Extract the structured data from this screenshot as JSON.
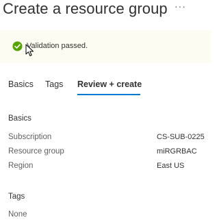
{
  "header": {
    "title": "Create a resource group",
    "more_label": "···"
  },
  "validation": {
    "icon": "check-circle-icon",
    "message": "Validation passed.",
    "status_color": "#57a300"
  },
  "tabs": [
    {
      "label": "Basics",
      "selected": false
    },
    {
      "label": "Tags",
      "selected": false
    },
    {
      "label": "Review + create",
      "selected": true
    }
  ],
  "accent_color": "#0078d4",
  "basics": {
    "heading": "Basics",
    "fields": [
      {
        "label": "Subscription",
        "value": "CS-SUB-0225"
      },
      {
        "label": "Resource group",
        "value": "miRGRBAC"
      },
      {
        "label": "Region",
        "value": "East US"
      }
    ]
  },
  "tags": {
    "heading": "Tags",
    "empty_text": "None"
  }
}
